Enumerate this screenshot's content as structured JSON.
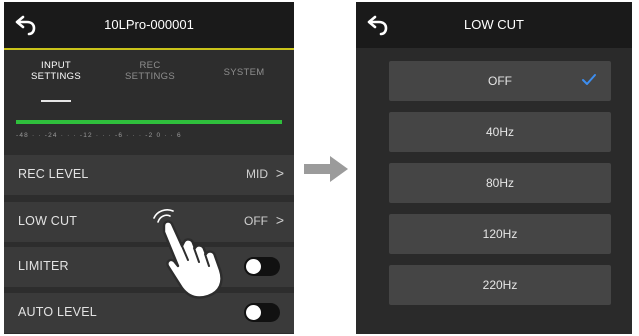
{
  "left": {
    "title": "10LPro-000001",
    "tabs": [
      {
        "line1": "INPUT",
        "line2": "SETTINGS"
      },
      {
        "line1": "REC",
        "line2": "SETTINGS"
      },
      {
        "line1": "SYSTEM",
        "line2": ""
      }
    ],
    "meter_scale": "-48 · · -24 · · · -12 · · · -6 · · · -2 0 · · 6",
    "rows": {
      "rec_level": {
        "label": "REC LEVEL",
        "value": "MID",
        "chevron": ">"
      },
      "low_cut": {
        "label": "LOW CUT",
        "value": "OFF",
        "chevron": ">"
      },
      "limiter": {
        "label": "LIMITER",
        "state": "off"
      },
      "auto_level": {
        "label": "AUTO LEVEL",
        "state": "off"
      }
    }
  },
  "right": {
    "title": "LOW CUT",
    "options": [
      "OFF",
      "40Hz",
      "80Hz",
      "120Hz",
      "220Hz"
    ],
    "selected": "OFF"
  },
  "colors": {
    "accent_check": "#3d8ef0",
    "meter_green": "#2fbf3c",
    "header_line": "#c9c31a"
  },
  "icons": [
    "back-arrow-icon",
    "checkmark-icon",
    "tap-hand-icon",
    "right-arrow-icon"
  ]
}
